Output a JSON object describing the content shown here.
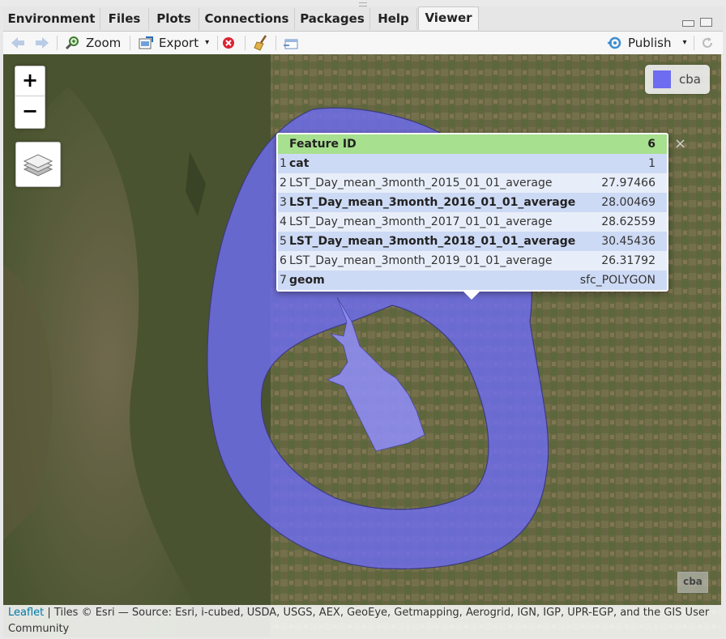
{
  "tabs": [
    "Environment",
    "Files",
    "Plots",
    "Connections",
    "Packages",
    "Help",
    "Viewer"
  ],
  "active_tab": "Viewer",
  "toolbar": {
    "zoom_label": "Zoom",
    "export_label": "Export",
    "publish_label": "Publish"
  },
  "map": {
    "zoom_in": "+",
    "zoom_out": "−",
    "legend_label": "cba",
    "legend_color": "#6e6cf0",
    "minimap_label": "cba"
  },
  "popup": {
    "header_key": "Feature ID",
    "header_value": "6",
    "close_symbol": "×",
    "rows": [
      {
        "idx": "1",
        "key": "cat",
        "value": "1"
      },
      {
        "idx": "2",
        "key": "LST_Day_mean_3month_2015_01_01_average",
        "value": "27.97466"
      },
      {
        "idx": "3",
        "key": "LST_Day_mean_3month_2016_01_01_average",
        "value": "28.00469"
      },
      {
        "idx": "4",
        "key": "LST_Day_mean_3month_2017_01_01_average",
        "value": "28.62559"
      },
      {
        "idx": "5",
        "key": "LST_Day_mean_3month_2018_01_01_average",
        "value": "30.45436"
      },
      {
        "idx": "6",
        "key": "LST_Day_mean_3month_2019_01_01_average",
        "value": "26.31792"
      },
      {
        "idx": "7",
        "key": "geom",
        "value": "sfc_POLYGON"
      }
    ]
  },
  "attribution": {
    "leaflet_link": "Leaflet",
    "text": " | Tiles © Esri — Source: Esri, i-cubed, USDA, USGS, AEX, GeoEye, Getmapping, Aerogrid, IGN, IGP, UPR-EGP, and the GIS User Community"
  }
}
